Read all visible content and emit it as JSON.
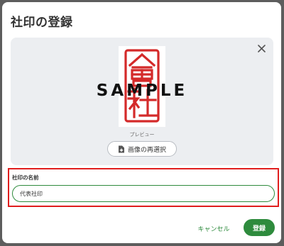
{
  "dialog": {
    "title": "社印の登録",
    "close_icon": "close-icon"
  },
  "preview": {
    "watermark": "SAMPLE",
    "caption": "プレビュー",
    "seal_characters": "會社",
    "seal_color": "#d42a2a",
    "reselect_button": {
      "label": "画像の再選択",
      "icon": "image-file-plus-icon"
    }
  },
  "form": {
    "name_label": "社印の名前",
    "name_value": "代表社印",
    "input_border_color": "#2e8b3d",
    "highlight_color": "#e01e1e"
  },
  "actions": {
    "cancel_label": "キャンセル",
    "submit_label": "登録",
    "accent_color": "#2e8b3d"
  }
}
